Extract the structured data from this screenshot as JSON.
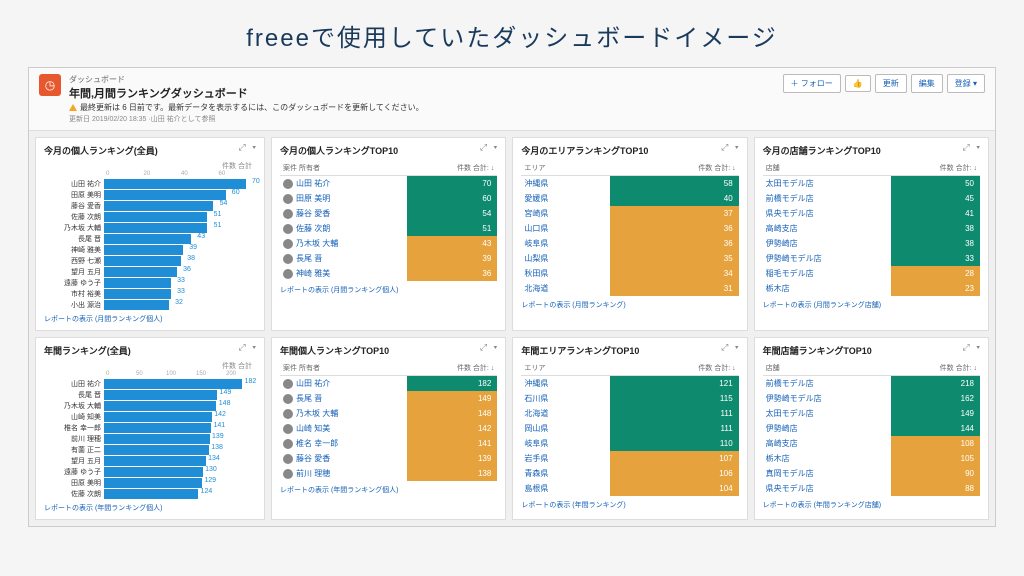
{
  "page_heading": "freeeで使用していたダッシュボードイメージ",
  "header": {
    "breadcrumb": "ダッシュボード",
    "title": "年間,月間ランキングダッシュボード",
    "warning": "最終更新は 6 日前です。最新データを表示するには、このダッシュボードを更新してください。",
    "updated": "更新日 2019/02/20 18:35 ·山田 祐介として参照",
    "actions": {
      "follow": "＋ フォロー",
      "like": "👍",
      "refresh": "更新",
      "edit": "編集",
      "register": "登録 ▾"
    }
  },
  "panels": {
    "p1": {
      "title": "今月の個人ランキング(全員)",
      "axis": "件数 合計",
      "scale": [
        "0",
        "20",
        "40",
        "60"
      ],
      "link": "レポートの表示 (月間ランキング個人)"
    },
    "p2": {
      "title": "今月の個人ランキングTOP10",
      "col1": "案件 所有者",
      "col2": "件数 合計: ↓",
      "link": "レポートの表示 (月間ランキング個人)"
    },
    "p3": {
      "title": "今月のエリアランキングTOP10",
      "col1": "エリア",
      "col2": "件数 合計: ↓",
      "link": "レポートの表示 (月間ランキング)"
    },
    "p4": {
      "title": "今月の店舗ランキングTOP10",
      "col1": "店舗",
      "col2": "件数 合計: ↓",
      "link": "レポートの表示 (月間ランキング店舗)"
    },
    "p5": {
      "title": "年間ランキング(全員)",
      "axis": "件数 合計",
      "scale": [
        "0",
        "50",
        "100",
        "150",
        "200"
      ],
      "link": "レポートの表示 (年間ランキング個人)"
    },
    "p6": {
      "title": "年間個人ランキングTOP10",
      "col1": "案件 所有者",
      "col2": "件数 合計: ↓",
      "link": "レポートの表示 (年間ランキング個人)"
    },
    "p7": {
      "title": "年間エリアランキングTOP10",
      "col1": "エリア",
      "col2": "件数 合計: ↓",
      "link": "レポートの表示 (年間ランキング)"
    },
    "p8": {
      "title": "年間店舗ランキングTOP10",
      "col1": "店舗",
      "col2": "件数 合計: ↓",
      "link": "レポートの表示 (年間ランキング店舗)"
    }
  },
  "chart_data": [
    {
      "type": "bar",
      "title": "今月の個人ランキング(全員)",
      "xlabel": "件数 合計",
      "xlim": [
        0,
        75
      ],
      "categories": [
        "山田 祐介",
        "田原 美明",
        "藤谷 愛香",
        "佐藤 次朗",
        "乃木坂 大輔",
        "長尾 晋",
        "神崎 雅美",
        "西野 七瀬",
        "望月 五月",
        "遠藤 ゆう子",
        "市村 裕美",
        "小出 源治"
      ],
      "values": [
        70,
        60,
        54,
        51,
        51,
        43,
        39,
        38,
        36,
        33,
        33,
        32
      ]
    },
    {
      "type": "table",
      "title": "今月の個人ランキングTOP10",
      "rows": [
        [
          "山田 祐介",
          70
        ],
        [
          "田原 美明",
          60
        ],
        [
          "藤谷 愛香",
          54
        ],
        [
          "佐藤 次朗",
          51
        ],
        [
          "乃木坂 大輔",
          43
        ],
        [
          "長尾 晋",
          39
        ],
        [
          "神崎 雅美",
          36
        ]
      ]
    },
    {
      "type": "table",
      "title": "今月のエリアランキングTOP10",
      "rows": [
        [
          "沖縄県",
          58
        ],
        [
          "愛媛県",
          40
        ],
        [
          "宮崎県",
          37
        ],
        [
          "山口県",
          36
        ],
        [
          "岐阜県",
          36
        ],
        [
          "山梨県",
          35
        ],
        [
          "秋田県",
          34
        ],
        [
          "北海道",
          31
        ]
      ]
    },
    {
      "type": "table",
      "title": "今月の店舗ランキングTOP10",
      "rows": [
        [
          "太田モデル店",
          50
        ],
        [
          "前橋モデル店",
          45
        ],
        [
          "県央モデル店",
          41
        ],
        [
          "高崎支店",
          38
        ],
        [
          "伊勢崎店",
          38
        ],
        [
          "伊勢崎モデル店",
          33
        ],
        [
          "稲毛モデル店",
          28
        ],
        [
          "栃木店",
          23
        ]
      ]
    },
    {
      "type": "bar",
      "title": "年間ランキング(全員)",
      "xlabel": "件数 合計",
      "xlim": [
        0,
        200
      ],
      "categories": [
        "山田 祐介",
        "長尾 晋",
        "乃木坂 大輔",
        "山崎 知美",
        "椎名 幸一郎",
        "前川 理穂",
        "有薗 正二",
        "望月 五月",
        "遠藤 ゆう子",
        "田原 美明",
        "佐藤 次朗"
      ],
      "values": [
        182,
        149,
        148,
        142,
        141,
        139,
        138,
        134,
        130,
        129,
        124
      ]
    },
    {
      "type": "table",
      "title": "年間個人ランキングTOP10",
      "rows": [
        [
          "山田 祐介",
          182
        ],
        [
          "長尾 晋",
          149
        ],
        [
          "乃木坂 大輔",
          148
        ],
        [
          "山崎 知美",
          142
        ],
        [
          "椎名 幸一郎",
          141
        ],
        [
          "藤谷 愛香",
          139
        ],
        [
          "前川 理穂",
          138
        ]
      ]
    },
    {
      "type": "table",
      "title": "年間エリアランキングTOP10",
      "rows": [
        [
          "沖縄県",
          121
        ],
        [
          "石川県",
          115
        ],
        [
          "北海道",
          111
        ],
        [
          "岡山県",
          111
        ],
        [
          "岐阜県",
          110
        ],
        [
          "岩手県",
          107
        ],
        [
          "青森県",
          106
        ],
        [
          "島根県",
          104
        ]
      ]
    },
    {
      "type": "table",
      "title": "年間店舗ランキングTOP10",
      "rows": [
        [
          "前橋モデル店",
          218
        ],
        [
          "伊勢崎モデル店",
          162
        ],
        [
          "太田モデル店",
          149
        ],
        [
          "伊勢崎店",
          144
        ],
        [
          "高崎支店",
          108
        ],
        [
          "栃木店",
          105
        ],
        [
          "真岡モデル店",
          90
        ],
        [
          "県央モデル店",
          88
        ]
      ]
    }
  ],
  "colors": {
    "teal": "#0e8a6e",
    "amber": "#e6a23c",
    "blue": "#1f8ed6"
  }
}
